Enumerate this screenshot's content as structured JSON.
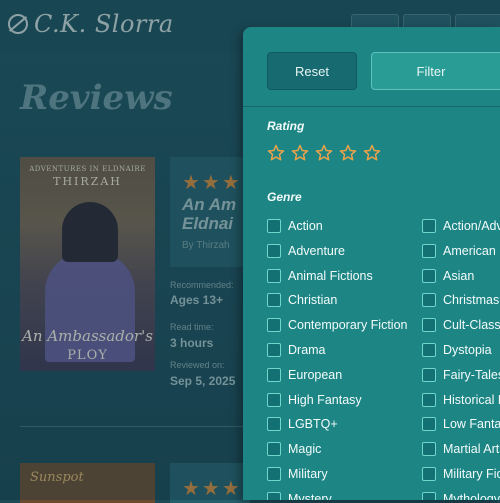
{
  "site": {
    "logo_text": "C.K. Slorra"
  },
  "page": {
    "title": "Reviews"
  },
  "review1": {
    "cover": {
      "series": "ADVENTURES IN ELDNAIRE",
      "author": "THIRZAH",
      "title": "An Ambassador's",
      "subtitle": "PLOY"
    },
    "rating": 5,
    "title_line1": "An Am",
    "title_line2": "Eldnai",
    "byline": "By Thirzah",
    "recommended_label": "Recommended:",
    "recommended_value": "Ages 13+",
    "read_time_label": "Read time:",
    "read_time_value": "3 hours",
    "reviewed_label": "Reviewed on:",
    "reviewed_value": "Sep 5, 2025"
  },
  "review2": {
    "cover_text": "Sunspot"
  },
  "filter_panel": {
    "reset_label": "Reset",
    "filter_label": "Filter",
    "rating_heading": "Rating",
    "rating_stars": 5,
    "genre_heading": "Genre",
    "genres_col1": [
      "Action",
      "Adventure",
      "Animal Fictions",
      "Christian",
      "Contemporary Fiction",
      "Drama",
      "European",
      "High Fantasy",
      "LGBTQ+",
      "Magic",
      "Military",
      "Mystery"
    ],
    "genres_col2": [
      "Action/Adventure",
      "American",
      "Asian",
      "Christmas",
      "Cult-Classic",
      "Dystopia",
      "Fairy-Tales",
      "Historical Fiction",
      "Low Fantasy",
      "Martial Arts",
      "Military Fiction",
      "Mythology"
    ]
  },
  "colors": {
    "accent": "#1e8585",
    "star": "#d98a3a",
    "background": "#1c4a57"
  }
}
